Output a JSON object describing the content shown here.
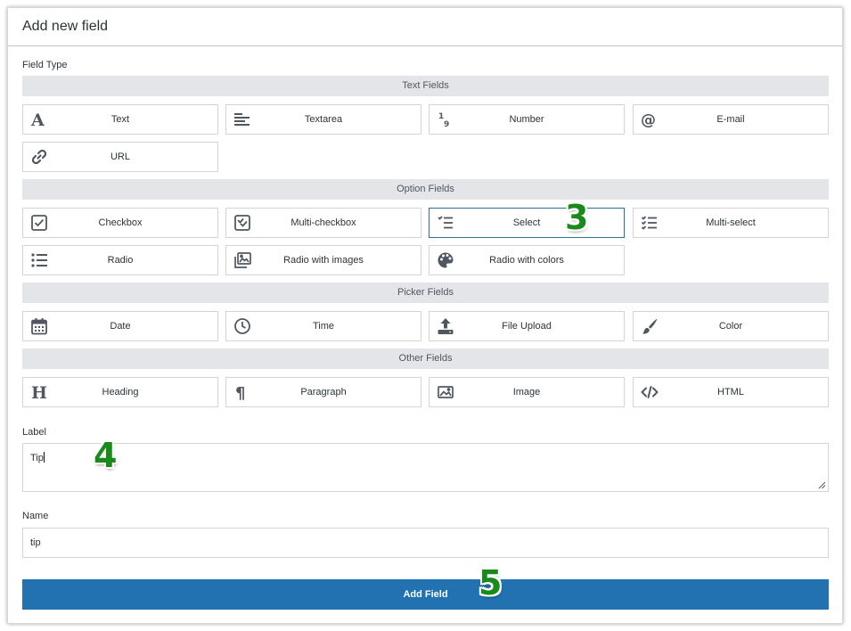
{
  "dialog": {
    "title": "Add new field"
  },
  "field_type": {
    "label": "Field Type",
    "sections": [
      {
        "title": "Text Fields",
        "items": [
          {
            "label": "Text",
            "icon": "text-a-icon"
          },
          {
            "label": "Textarea",
            "icon": "align-left-icon"
          },
          {
            "label": "Number",
            "icon": "number-icon"
          },
          {
            "label": "E-mail",
            "icon": "at-sign-icon"
          },
          {
            "label": "URL",
            "icon": "link-icon"
          }
        ]
      },
      {
        "title": "Option Fields",
        "items": [
          {
            "label": "Checkbox",
            "icon": "checkbox-icon"
          },
          {
            "label": "Multi-checkbox",
            "icon": "multi-checkbox-icon"
          },
          {
            "label": "Select",
            "icon": "select-list-icon",
            "selected": true
          },
          {
            "label": "Multi-select",
            "icon": "multi-select-icon"
          },
          {
            "label": "Radio",
            "icon": "bullet-list-icon"
          },
          {
            "label": "Radio with images",
            "icon": "images-icon"
          },
          {
            "label": "Radio with colors",
            "icon": "palette-icon"
          }
        ]
      },
      {
        "title": "Picker Fields",
        "items": [
          {
            "label": "Date",
            "icon": "calendar-icon"
          },
          {
            "label": "Time",
            "icon": "clock-icon"
          },
          {
            "label": "File Upload",
            "icon": "upload-icon"
          },
          {
            "label": "Color",
            "icon": "paintbrush-icon"
          }
        ]
      },
      {
        "title": "Other Fields",
        "items": [
          {
            "label": "Heading",
            "icon": "heading-icon"
          },
          {
            "label": "Paragraph",
            "icon": "paragraph-icon"
          },
          {
            "label": "Image",
            "icon": "image-icon"
          },
          {
            "label": "HTML",
            "icon": "code-icon"
          }
        ]
      }
    ]
  },
  "label_field": {
    "label": "Label",
    "value": "Tip"
  },
  "name_field": {
    "label": "Name",
    "value": "tip"
  },
  "submit": {
    "label": "Add Field"
  },
  "steps": [
    "3",
    "4",
    "5"
  ],
  "colors": {
    "primary": "#2271b1",
    "step_marker": "#1a8a1a",
    "section_bg": "#e4e5e8",
    "selected_border": "#2c6f8e"
  }
}
